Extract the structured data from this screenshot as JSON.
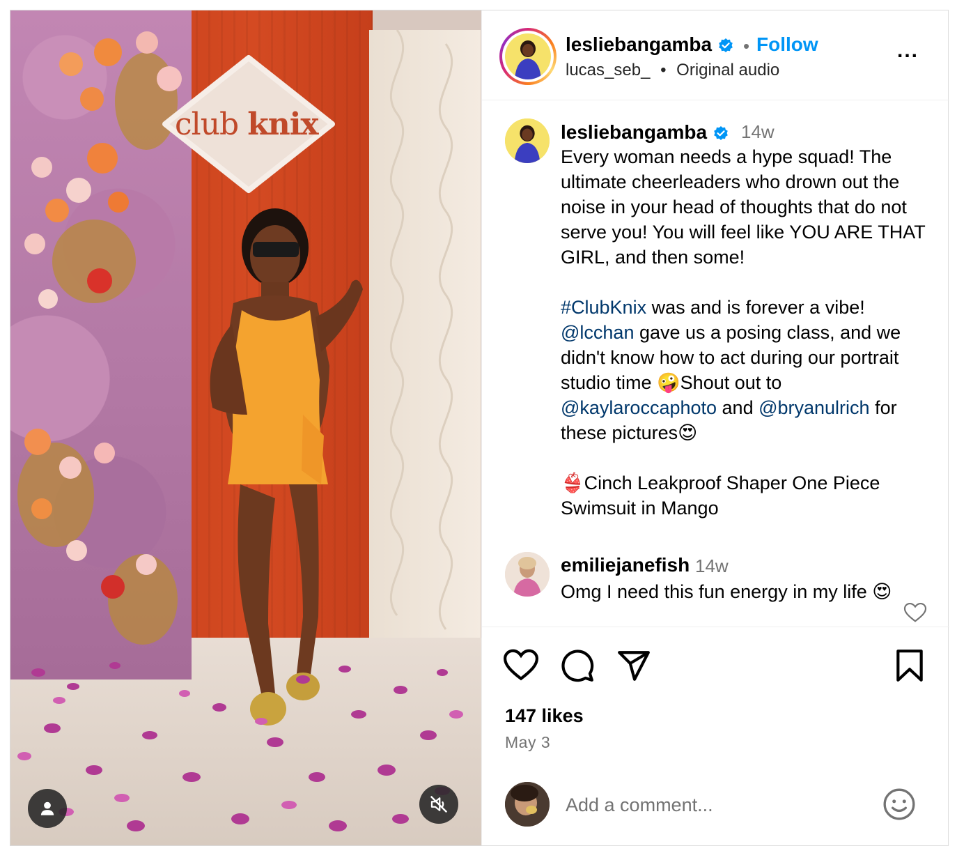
{
  "post": {
    "author": "lesliebangamba",
    "follow_label": "Follow",
    "audio_user": "lucas_seb_",
    "audio_label": "Original audio",
    "separator": "•",
    "more_label": "..."
  },
  "media": {
    "sign_text_light": "club",
    "sign_text_bold": "knix"
  },
  "caption": {
    "user": "lesliebangamba",
    "time": "14w",
    "line1": "Every woman needs a hype squad! The ultimate cheerleaders who drown out the noise in your head of thoughts that do not serve you! You will feel like YOU ARE THAT GIRL, and then some!",
    "hashtag": "#ClubKnix",
    "after_hashtag": " was and is forever a vibe!",
    "mention1": "@lcchan",
    "after_mention1": " gave us a posing class, and we didn't know how to act during our portrait studio time 🤪Shout out to ",
    "mention2": "@kaylaroccaphoto",
    "and_text": " and ",
    "mention3": "@bryanulrich",
    "after_mention3": " for these pictures😍",
    "product": "👙Cinch Leakproof Shaper One Piece Swimsuit in Mango"
  },
  "comment": {
    "user": "emiliejanefish",
    "time": "14w",
    "text": "Omg I need this fun energy in my life 😍"
  },
  "stats": {
    "likes": "147 likes",
    "date": "May 3"
  },
  "add_comment": {
    "placeholder": "Add a comment..."
  },
  "colors": {
    "link_blue": "#0095f6",
    "tag_blue": "#00376b",
    "muted_gray": "#737373",
    "verified_blue": "#0095f6"
  }
}
